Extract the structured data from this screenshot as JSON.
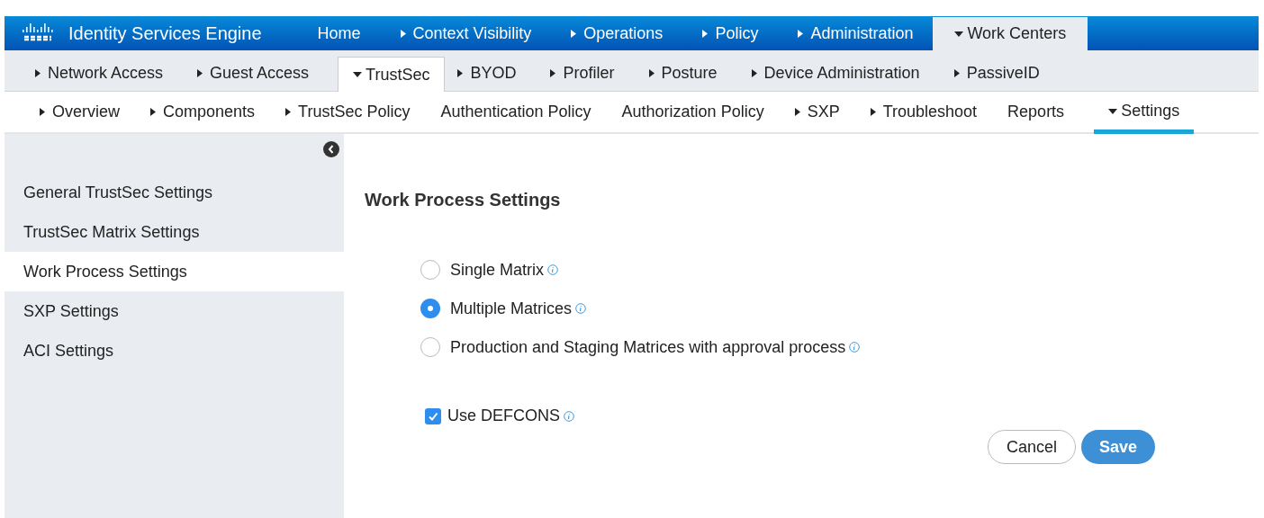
{
  "header": {
    "product": "Identity Services Engine",
    "tabs": [
      {
        "label": "Home",
        "expandable": false,
        "expanded": false,
        "selected": false
      },
      {
        "label": "Context Visibility",
        "expandable": true,
        "expanded": false,
        "selected": false
      },
      {
        "label": "Operations",
        "expandable": true,
        "expanded": false,
        "selected": false
      },
      {
        "label": "Policy",
        "expandable": true,
        "expanded": false,
        "selected": false
      },
      {
        "label": "Administration",
        "expandable": true,
        "expanded": false,
        "selected": false
      },
      {
        "label": "Work Centers",
        "expandable": true,
        "expanded": true,
        "selected": true
      }
    ]
  },
  "subnav": [
    {
      "label": "Network Access",
      "expandable": true,
      "expanded": false,
      "selected": false
    },
    {
      "label": "Guest Access",
      "expandable": true,
      "expanded": false,
      "selected": false
    },
    {
      "label": "TrustSec",
      "expandable": true,
      "expanded": true,
      "selected": true
    },
    {
      "label": "BYOD",
      "expandable": true,
      "expanded": false,
      "selected": false
    },
    {
      "label": "Profiler",
      "expandable": true,
      "expanded": false,
      "selected": false
    },
    {
      "label": "Posture",
      "expandable": true,
      "expanded": false,
      "selected": false
    },
    {
      "label": "Device Administration",
      "expandable": true,
      "expanded": false,
      "selected": false
    },
    {
      "label": "PassiveID",
      "expandable": true,
      "expanded": false,
      "selected": false
    }
  ],
  "menu": [
    {
      "label": "Overview",
      "expandable": true,
      "expanded": false,
      "selected": false
    },
    {
      "label": "Components",
      "expandable": true,
      "expanded": false,
      "selected": false
    },
    {
      "label": "TrustSec Policy",
      "expandable": true,
      "expanded": false,
      "selected": false
    },
    {
      "label": "Authentication Policy",
      "expandable": false,
      "expanded": false,
      "selected": false
    },
    {
      "label": "Authorization Policy",
      "expandable": false,
      "expanded": false,
      "selected": false
    },
    {
      "label": "SXP",
      "expandable": true,
      "expanded": false,
      "selected": false
    },
    {
      "label": "Troubleshoot",
      "expandable": true,
      "expanded": false,
      "selected": false
    },
    {
      "label": "Reports",
      "expandable": false,
      "expanded": false,
      "selected": false
    },
    {
      "label": "Settings",
      "expandable": true,
      "expanded": true,
      "selected": true
    }
  ],
  "sidebar": {
    "items": [
      {
        "label": "General TrustSec Settings",
        "selected": false
      },
      {
        "label": "TrustSec Matrix Settings",
        "selected": false
      },
      {
        "label": "Work Process Settings",
        "selected": true
      },
      {
        "label": "SXP Settings",
        "selected": false
      },
      {
        "label": "ACI Settings",
        "selected": false
      }
    ]
  },
  "content": {
    "title": "Work Process Settings",
    "options": [
      {
        "label": "Single Matrix",
        "selected": false
      },
      {
        "label": "Multiple Matrices",
        "selected": true
      },
      {
        "label": "Production and Staging Matrices with approval process",
        "selected": false
      }
    ],
    "defcons": {
      "label": "Use DEFCONS",
      "checked": true
    },
    "buttons": [
      {
        "label": "Cancel",
        "kind": "secondary"
      },
      {
        "label": "Save",
        "kind": "primary"
      }
    ]
  }
}
